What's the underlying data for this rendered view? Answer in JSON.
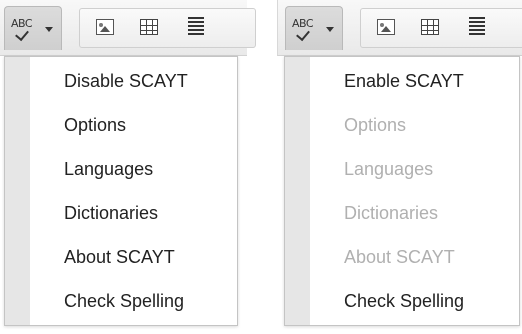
{
  "toolbar": {
    "spellcheck_label": "ABC",
    "icons": [
      "image-icon",
      "table-icon",
      "text-align-icon"
    ]
  },
  "left_menu": {
    "items": [
      {
        "label": "Disable SCAYT",
        "enabled": true
      },
      {
        "label": "Options",
        "enabled": true
      },
      {
        "label": "Languages",
        "enabled": true
      },
      {
        "label": "Dictionaries",
        "enabled": true
      },
      {
        "label": "About SCAYT",
        "enabled": true
      },
      {
        "label": "Check Spelling",
        "enabled": true
      }
    ]
  },
  "right_menu": {
    "items": [
      {
        "label": "Enable SCAYT",
        "enabled": true
      },
      {
        "label": "Options",
        "enabled": false
      },
      {
        "label": "Languages",
        "enabled": false
      },
      {
        "label": "Dictionaries",
        "enabled": false
      },
      {
        "label": "About SCAYT",
        "enabled": false
      },
      {
        "label": "Check Spelling",
        "enabled": true
      }
    ]
  },
  "colors": {
    "enabled_text": "#222222",
    "disabled_text": "#b0b0b0",
    "gutter": "#e6e6e6"
  }
}
